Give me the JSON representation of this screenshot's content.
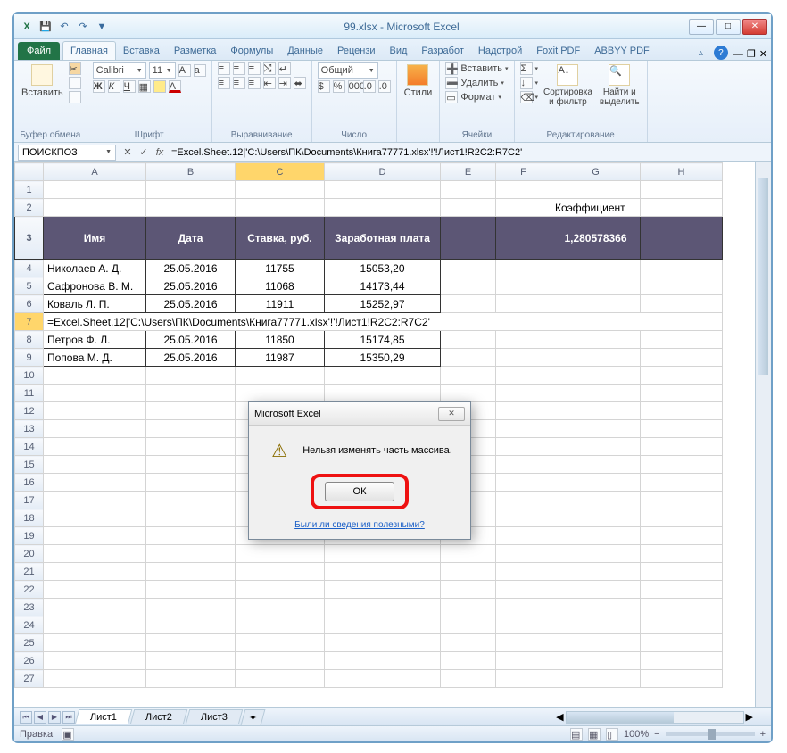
{
  "window": {
    "title": "99.xlsx - Microsoft Excel"
  },
  "qat": {
    "excel": "X",
    "save": "💾",
    "undo": "↶",
    "redo": "↷"
  },
  "tabs": {
    "file": "Файл",
    "home": "Главная",
    "insert": "Вставка",
    "layout": "Разметка",
    "formulas": "Формулы",
    "data": "Данные",
    "review": "Рецензи",
    "view": "Вид",
    "developer": "Разработ",
    "addins": "Надстрой",
    "foxit": "Foxit PDF",
    "abbyy": "ABBYY PDF"
  },
  "ribbon": {
    "clipboard": {
      "paste": "Вставить",
      "group": "Буфер обмена"
    },
    "font": {
      "name": "Calibri",
      "size": "11",
      "group": "Шрифт"
    },
    "align": {
      "group": "Выравнивание"
    },
    "number": {
      "format": "Общий",
      "group": "Число"
    },
    "styles": {
      "btn": "Стили"
    },
    "cells": {
      "insert": "Вставить",
      "delete": "Удалить",
      "format": "Формат",
      "group": "Ячейки"
    },
    "editing": {
      "sort": "Сортировка\nи фильтр",
      "find": "Найти и\nвыделить",
      "group": "Редактирование"
    }
  },
  "formula_bar": {
    "name_box": "ПОИСКПОЗ",
    "formula": "=Excel.Sheet.12|'C:\\Users\\ПК\\Documents\\Книга77771.xlsx'!'!Лист1!R2C2:R7C2'"
  },
  "columns": [
    "A",
    "B",
    "C",
    "D",
    "E",
    "F",
    "G",
    "H"
  ],
  "table": {
    "headers": {
      "name": "Имя",
      "date": "Дата",
      "rate": "Ставка, руб.",
      "salary": "Заработная плата"
    },
    "rows": [
      {
        "name": "Николаев А. Д.",
        "date": "25.05.2016",
        "rate": "11755",
        "salary": "15053,20"
      },
      {
        "name": "Сафронова В. М.",
        "date": "25.05.2016",
        "rate": "11068",
        "salary": "14173,44"
      },
      {
        "name": "Коваль Л. П.",
        "date": "25.05.2016",
        "rate": "11911",
        "salary": "15252,97"
      },
      {
        "name": "Петров Ф. Л.",
        "date": "25.05.2016",
        "rate": "11850",
        "salary": "15174,85"
      },
      {
        "name": "Попова М. Д.",
        "date": "25.05.2016",
        "rate": "11987",
        "salary": "15350,29"
      }
    ],
    "edit_row": "=Excel.Sheet.12|'C:\\Users\\ПК\\Documents\\Книга77771.xlsx'!'!Лист1!R2C2:R7C2'"
  },
  "coef": {
    "label": "Коэффициент",
    "value": "1,280578366"
  },
  "sheets": {
    "s1": "Лист1",
    "s2": "Лист2",
    "s3": "Лист3"
  },
  "status": {
    "mode": "Правка",
    "zoom": "100%"
  },
  "dialog": {
    "title": "Microsoft Excel",
    "msg": "Нельзя изменять часть массива.",
    "ok": "ОК",
    "link": "Были ли сведения полезными?"
  }
}
